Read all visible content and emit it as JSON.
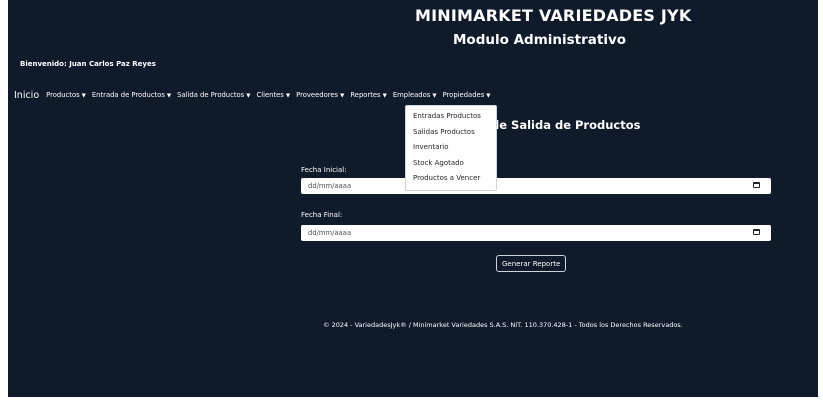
{
  "header": {
    "title": "MINIMARKET VARIEDADES JYK",
    "subtitle": "Modulo Administrativo",
    "welcome": "Bienvenido: Juan Carlos Paz Reyes"
  },
  "nav": {
    "home": "Inicio",
    "items": [
      "Productos",
      "Entrada de Productos",
      "Salida de Productos",
      "Clientes",
      "Proveedores",
      "Reportes",
      "Empleados",
      "Propiedades"
    ]
  },
  "reports_menu": {
    "items": [
      "Entradas Productos",
      "Salidas Productos",
      "Inventario",
      "Stock Agotado",
      "Productos a Vencer"
    ]
  },
  "form": {
    "title": "de Salida de Productos",
    "start_label": "Fecha Inicial:",
    "start_value": "dd/mm/aaaa",
    "end_label": "Fecha Final:",
    "end_value": "dd/mm/aaaa",
    "button": "Generar Reporte"
  },
  "footer": {
    "text": "© 2024 - VariedadesJyk® / Minimarket Variedades S.A.S. NIT. 110.370.428-1 - Todos los Derechos Reservados."
  },
  "colors": {
    "background": "#0f1a2b",
    "text": "#ffffff",
    "dropdown_bg": "#ffffff"
  }
}
